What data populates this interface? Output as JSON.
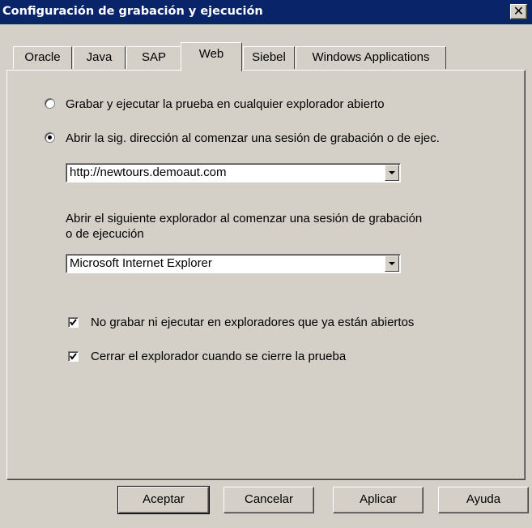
{
  "window": {
    "title": "Configuración de grabación y ejecución",
    "close_glyph": "✕"
  },
  "tabs": [
    {
      "label": "Oracle"
    },
    {
      "label": "Java"
    },
    {
      "label": "SAP"
    },
    {
      "label": "Web",
      "selected": true
    },
    {
      "label": "Siebel"
    },
    {
      "label": "Windows Applications"
    }
  ],
  "web": {
    "radio_any_browser": {
      "label": "Grabar y ejecutar la prueba en cualquier explorador abierto",
      "selected": false
    },
    "radio_open_url": {
      "label": "Abrir la sig. dirección al comenzar una sesión de grabación o de ejec.",
      "selected": true
    },
    "url_combo": {
      "value": "http://newtours.demoaut.com"
    },
    "browser_prompt": {
      "line1": "Abrir el siguiente explorador al comenzar una sesión de grabación",
      "line2": "o de ejecución"
    },
    "browser_combo": {
      "value": "Microsoft Internet Explorer"
    },
    "check_no_open_browsers": {
      "label": "No grabar ni ejecutar en exploradores que ya están abiertos",
      "checked": true
    },
    "check_close_browser": {
      "label": "Cerrar el explorador cuando se cierre la prueba",
      "checked": true
    }
  },
  "buttons": {
    "ok": "Aceptar",
    "cancel": "Cancelar",
    "apply": "Aplicar",
    "help": "Ayuda"
  }
}
